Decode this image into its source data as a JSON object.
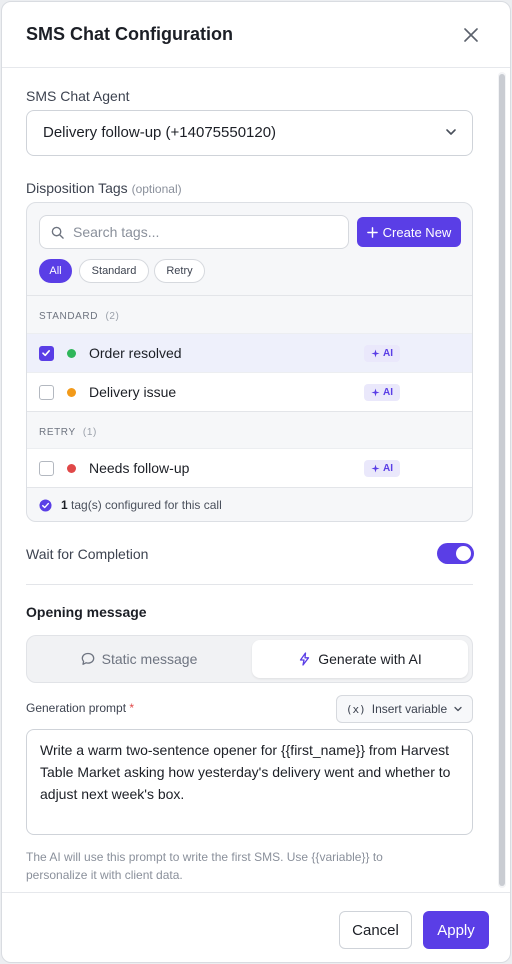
{
  "dialog": {
    "title": "SMS Chat Configuration"
  },
  "agent": {
    "label": "SMS Chat Agent",
    "selected": "Delivery follow-up (+14075550120)"
  },
  "tags": {
    "label": "Disposition Tags",
    "optional": "(optional)",
    "search_placeholder": "Search tags...",
    "create_label": "Create New",
    "filters": [
      "All",
      "Standard",
      "Retry"
    ],
    "active_filter": "All",
    "groups": [
      {
        "name": "STANDARD",
        "count": "(2)",
        "items": [
          {
            "name": "Order resolved",
            "color": "#2fb65a",
            "checked": true,
            "badge": "AI"
          },
          {
            "name": "Delivery issue",
            "color": "#f29a1a",
            "checked": false,
            "badge": "AI"
          }
        ]
      },
      {
        "name": "RETRY",
        "count": "(1)",
        "items": [
          {
            "name": "Needs follow-up",
            "color": "#e04848",
            "checked": false,
            "badge": "AI"
          }
        ]
      }
    ],
    "summary_count": "1",
    "summary_text": "tag(s) configured for this call"
  },
  "wait": {
    "label": "Wait for Completion",
    "enabled": true
  },
  "opening": {
    "title": "Opening message",
    "modes": [
      "Static message",
      "Generate with AI"
    ],
    "active_mode": "Generate with AI",
    "prompt_label": "Generation prompt",
    "required_mark": "*",
    "insert_variable": "Insert variable",
    "insert_variable_icon": "(x)",
    "prompt_value": "Write a warm two-sentence opener for {{first_name}} from Harvest Table Market asking how yesterday's delivery went and whether to adjust next week's box.",
    "hint": "The AI will use this prompt to write the first SMS. Use {{variable}} to personalize it with client data."
  },
  "actions": {
    "cancel": "Cancel",
    "apply": "Apply"
  },
  "colors": {
    "accent": "#5a3ee6"
  }
}
